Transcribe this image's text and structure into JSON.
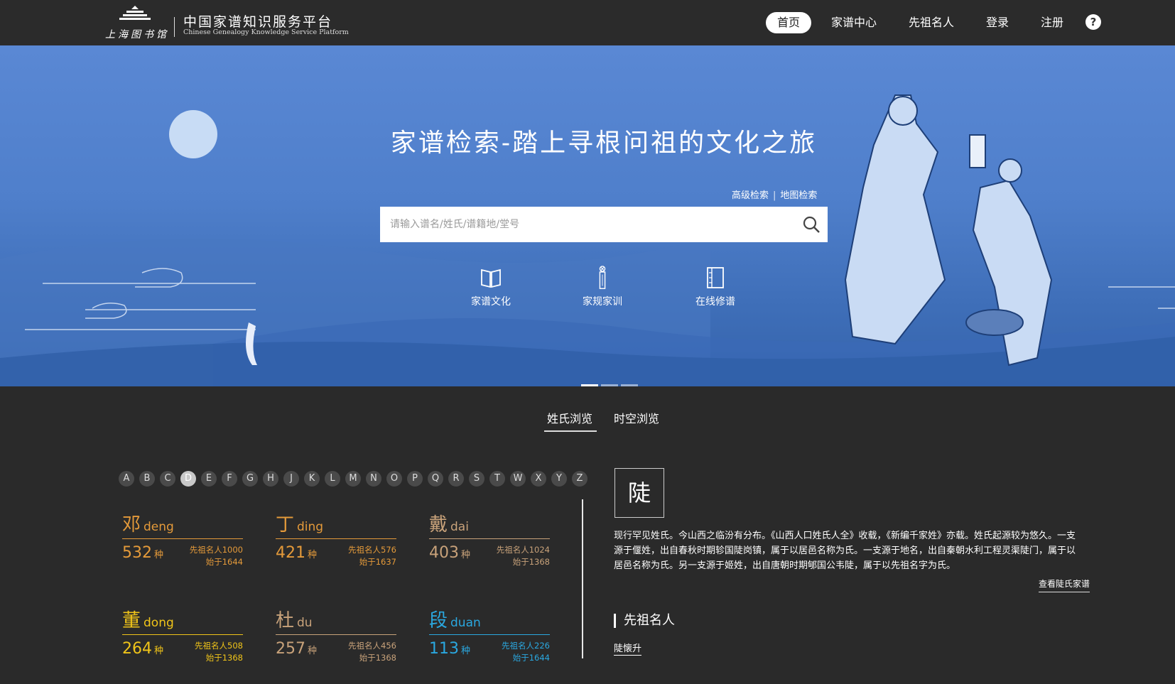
{
  "header": {
    "logo_mark_text": "上海图书馆",
    "logo_title": "中国家谱知识服务平台",
    "logo_subtitle": "Chinese Genealogy Knowledge Service Platform",
    "nav": [
      "首页",
      "家谱中心",
      "先祖名人",
      "登录",
      "注册"
    ],
    "help_label": "?"
  },
  "banner": {
    "title": "家谱检索-踏上寻根问祖的文化之旅",
    "advanced_search": "高级检索",
    "separator": "|",
    "map_search": "地图检索",
    "search_placeholder": "请输入谱名/姓氏/谱籍地/堂号",
    "search_value": "",
    "quick_links": [
      {
        "label": "家谱文化",
        "icon": "open-book-icon"
      },
      {
        "label": "家规家训",
        "icon": "scroll-icon"
      },
      {
        "label": "在线修谱",
        "icon": "bound-book-icon"
      }
    ],
    "carousel": {
      "count": 3,
      "active": 0
    }
  },
  "browse_tabs": [
    "姓氏浏览",
    "时空浏览"
  ],
  "alphabet": {
    "letters": [
      "A",
      "B",
      "C",
      "D",
      "E",
      "F",
      "G",
      "H",
      "J",
      "K",
      "L",
      "M",
      "N",
      "O",
      "P",
      "Q",
      "R",
      "S",
      "T",
      "W",
      "X",
      "Y",
      "Z"
    ],
    "selected": "D"
  },
  "surnames": [
    {
      "char": "邓",
      "pinyin": "deng",
      "count": "532",
      "unit": "种",
      "famous": "先祖名人1000",
      "since": "始于1644",
      "color": "orange"
    },
    {
      "char": "丁",
      "pinyin": "ding",
      "count": "421",
      "unit": "种",
      "famous": "先祖名人576",
      "since": "始于1637",
      "color": "orange"
    },
    {
      "char": "戴",
      "pinyin": "dai",
      "count": "403",
      "unit": "种",
      "famous": "先祖名人1024",
      "since": "始于1368",
      "color": "tan"
    },
    {
      "char": "董",
      "pinyin": "dong",
      "count": "264",
      "unit": "种",
      "famous": "先祖名人508",
      "since": "始于1368",
      "color": "yellow"
    },
    {
      "char": "杜",
      "pinyin": "du",
      "count": "257",
      "unit": "种",
      "famous": "先祖名人456",
      "since": "始于1368",
      "color": "tan"
    },
    {
      "char": "段",
      "pinyin": "duan",
      "count": "113",
      "unit": "种",
      "famous": "先祖名人226",
      "since": "始于1644",
      "color": "blue"
    }
  ],
  "detail": {
    "char": "陡",
    "description": "现行罕见姓氏。今山西之临汾有分布。《山西人口姓氏人全》收载，《新编千家姓》亦载。姓氏起源较为悠久。一支源于偃姓，出自春秋时期轸国陡岗镇，属于以居邑名称为氏。一支源于地名，出自秦朝水利工程灵渠陡门，属于以居邑名称为氏。另一支源于姬姓，出自唐朝时期郇国公韦陡，属于以先祖名字为氏。",
    "view_link": "查看陡氏家谱",
    "ancestor_heading": "先祖名人",
    "ancestors": [
      "陡懐升"
    ]
  }
}
